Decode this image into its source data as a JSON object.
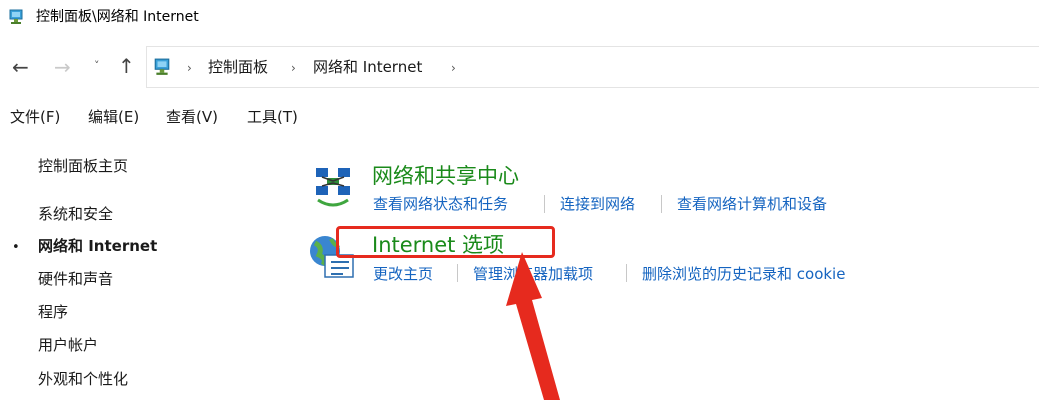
{
  "window": {
    "title": "控制面板\\网络和 Internet",
    "title_icon": "control-panel-icon"
  },
  "nav": {
    "back_glyph": "←",
    "forward_glyph": "→",
    "recent_glyph": "˅",
    "up_glyph": "↑",
    "breadcrumb": [
      "控制面板",
      "网络和 Internet"
    ],
    "separator": "›"
  },
  "menu": [
    "文件(F)",
    "编辑(E)",
    "查看(V)",
    "工具(T)"
  ],
  "sidebar": {
    "items": [
      {
        "label": "控制面板主页"
      },
      {
        "label": "系统和安全"
      },
      {
        "label": "网络和 Internet",
        "active": true
      },
      {
        "label": "硬件和声音"
      },
      {
        "label": "程序"
      },
      {
        "label": "用户帐户"
      },
      {
        "label": "外观和个性化"
      }
    ],
    "bullet": "•"
  },
  "categories": [
    {
      "title": "网络和共享中心",
      "icon": "network-sharing-icon",
      "links": [
        "查看网络状态和任务",
        "连接到网络",
        "查看网络计算机和设备"
      ]
    },
    {
      "title": "Internet 选项",
      "icon": "internet-options-icon",
      "links": [
        "更改主页",
        "管理浏览器加载项",
        "删除浏览的历史记录和 cookie"
      ]
    }
  ],
  "colors": {
    "title_green": "#1a8a1a",
    "link_blue": "#1564c0",
    "highlight_red": "#e62a1e"
  }
}
